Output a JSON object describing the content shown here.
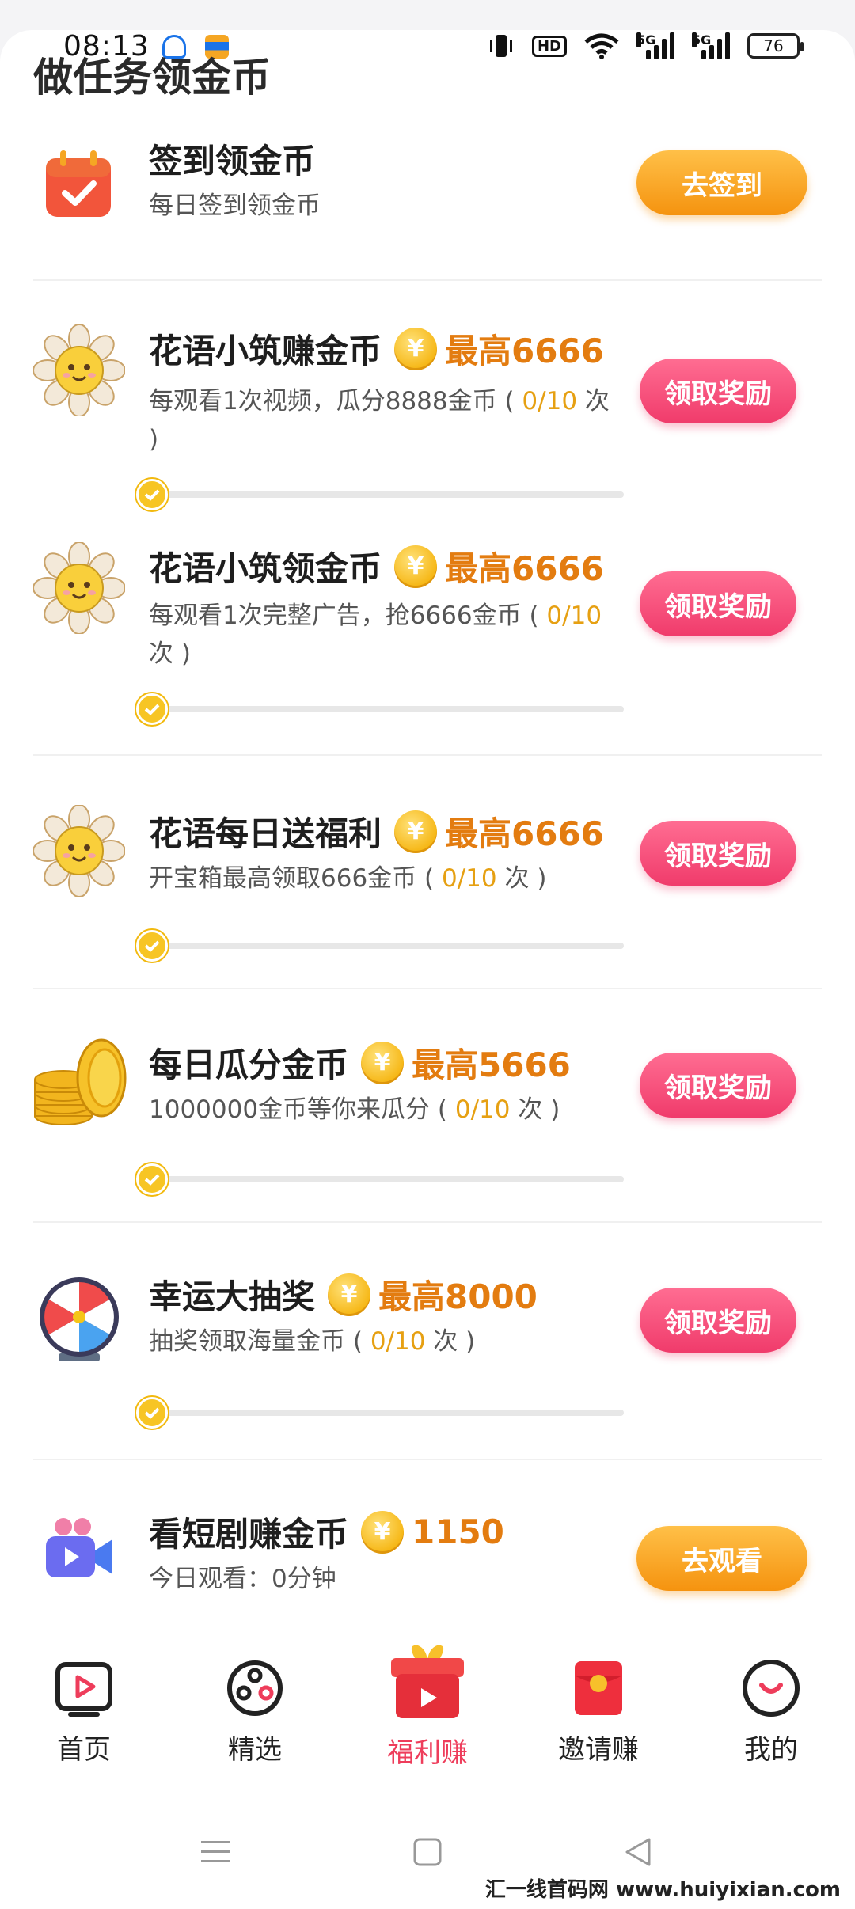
{
  "status_bar": {
    "time": "08:13",
    "battery": "76",
    "net1": "5G",
    "net2": "5G",
    "hd": "HD"
  },
  "page": {
    "title": "做任务领金币"
  },
  "tasks": [
    {
      "title": "签到领金币",
      "reward": "",
      "desc": "每日签到领金币",
      "progress": "",
      "desc_tail": "",
      "button": "去签到",
      "icon": "calendar-check-icon"
    },
    {
      "title": "花语小筑赚金币",
      "reward": "最高6666",
      "desc": "每观看1次视频，瓜分8888金币 ( ",
      "progress": "0/10",
      "desc_tail": " 次 )",
      "button": "领取奖励",
      "icon": "flower-icon"
    },
    {
      "title": "花语小筑领金币",
      "reward": "最高6666",
      "desc": "每观看1次完整广告，抢6666金币 ( ",
      "progress": "0/10",
      "desc_tail": " 次 )",
      "button": "领取奖励",
      "icon": "flower-icon"
    },
    {
      "title": "花语每日送福利",
      "reward": "最高6666",
      "desc": "开宝箱最高领取666金币 ( ",
      "progress": "0/10",
      "desc_tail": " 次 )",
      "button": "领取奖励",
      "icon": "flower-icon"
    },
    {
      "title": "每日瓜分金币",
      "reward": "最高5666",
      "desc": "1000000金币等你来瓜分 ( ",
      "progress": "0/10",
      "desc_tail": " 次 )",
      "button": "领取奖励",
      "icon": "coin-stack-icon"
    },
    {
      "title": "幸运大抽奖",
      "reward": "最高8000",
      "desc": "抽奖领取海量金币 ( ",
      "progress": "0/10",
      "desc_tail": " 次 )",
      "button": "领取奖励",
      "icon": "prize-wheel-icon"
    },
    {
      "title": "看短剧赚金币",
      "reward": "1150",
      "desc": "今日观看：0分钟",
      "progress": "",
      "desc_tail": "",
      "button": "去观看",
      "icon": "video-camera-icon"
    }
  ],
  "coin_symbol": "¥",
  "nav": [
    {
      "label": "首页",
      "icon": "tv-play-icon"
    },
    {
      "label": "精选",
      "icon": "film-reel-icon"
    },
    {
      "label": "福利赚",
      "icon": "gift-box-icon",
      "active": true
    },
    {
      "label": "邀请赚",
      "icon": "red-envelope-icon"
    },
    {
      "label": "我的",
      "icon": "smile-face-icon"
    }
  ],
  "watermark": "汇一线首码网 www.huiyixian.com",
  "colors": {
    "accent_orange": "#f5930f",
    "accent_pink": "#f03b6b",
    "reward_text": "#e37c10",
    "active_nav": "#ee3d5b"
  }
}
